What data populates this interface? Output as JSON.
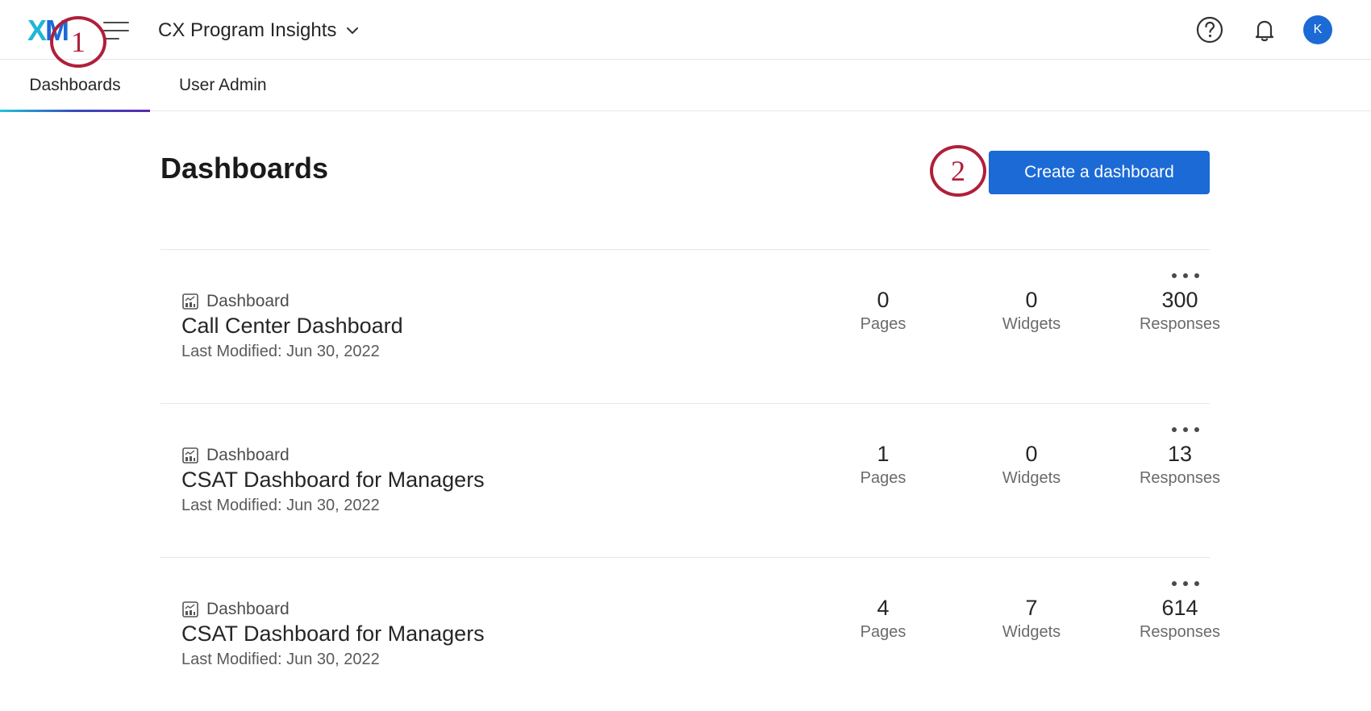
{
  "header": {
    "logo_left": "X",
    "logo_right": "M",
    "project_title": "CX Program Insights",
    "avatar_initial": "K"
  },
  "tabs": [
    {
      "label": "Dashboards",
      "active": true
    },
    {
      "label": "User Admin",
      "active": false
    }
  ],
  "page": {
    "title": "Dashboards",
    "create_label": "Create a dashboard"
  },
  "callouts": [
    "1",
    "2"
  ],
  "stat_labels": {
    "pages": "Pages",
    "widgets": "Widgets",
    "responses": "Responses"
  },
  "dashboards": [
    {
      "type": "Dashboard",
      "name": "Call Center Dashboard",
      "modified": "Last Modified: Jun 30, 2022",
      "pages": "0",
      "widgets": "0",
      "responses": "300"
    },
    {
      "type": "Dashboard",
      "name": "CSAT Dashboard for Managers",
      "modified": "Last Modified: Jun 30, 2022",
      "pages": "1",
      "widgets": "0",
      "responses": "13"
    },
    {
      "type": "Dashboard",
      "name": "CSAT Dashboard for Managers",
      "modified": "Last Modified: Jun 30, 2022",
      "pages": "4",
      "widgets": "7",
      "responses": "614"
    }
  ],
  "colors": {
    "accent": "#1b6ad6",
    "callout": "#b01f3a",
    "logo_cyan": "#1fb7d6"
  },
  "icons": [
    "hamburger-icon",
    "chevron-down-icon",
    "help-icon",
    "bell-icon",
    "dashboard-icon",
    "more-icon"
  ]
}
